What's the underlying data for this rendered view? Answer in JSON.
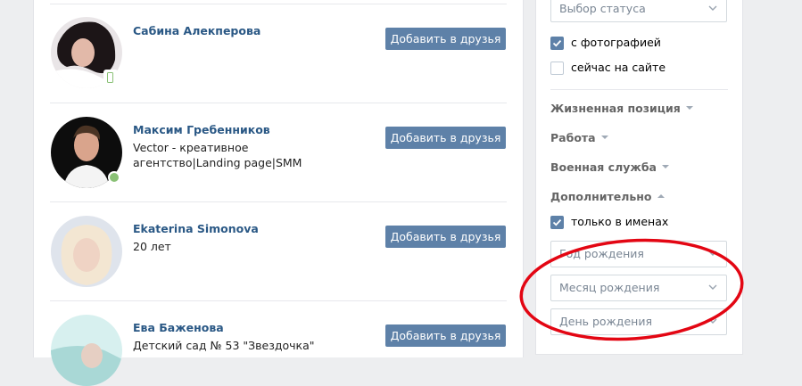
{
  "people": [
    {
      "name": "Сабина Алекперова",
      "sub": "",
      "button": "Добавить в друзья",
      "online": "mobile"
    },
    {
      "name": "Максим Гребенников",
      "sub": "Vector - креативное агентство|Landing page|SMM",
      "button": "Добавить в друзья",
      "online": "web"
    },
    {
      "name": "Ekaterina Simonova",
      "sub": "20 лет",
      "button": "Добавить в друзья",
      "online": ""
    },
    {
      "name": "Ева Баженова",
      "sub": "Детский сад № 53 \"Звездочка\"",
      "button": "Добавить в друзья",
      "online": ""
    }
  ],
  "filters": {
    "status_select": "Выбор статуса",
    "with_photo": {
      "label": "с фотографией",
      "checked": true
    },
    "online_now": {
      "label": "сейчас на сайте",
      "checked": false
    },
    "sections": {
      "life_position": "Жизненная позиция",
      "work": "Работа",
      "military": "Военная служба",
      "additional": "Дополнительно"
    },
    "names_only": {
      "label": "только в именах",
      "checked": true
    },
    "birth_year": "Год рождения",
    "birth_month": "Месяц рождения",
    "birth_day": "День рождения"
  },
  "colors": {
    "accent": "#5e81a8",
    "link": "#2a5885",
    "online": "#8ac176",
    "annotation": "#e30613"
  },
  "icons": [
    "phone-icon",
    "chevron-down-icon",
    "checkmark-icon",
    "caret-down-icon",
    "caret-up-icon"
  ]
}
